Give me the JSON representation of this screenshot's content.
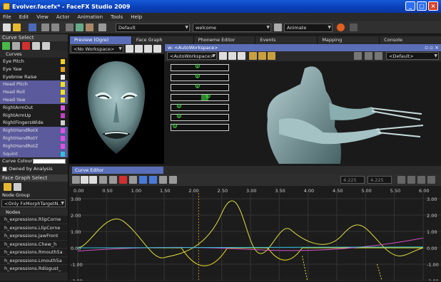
{
  "window": {
    "title": "Evolver.facefx* - FaceFX Studio 2009"
  },
  "menu": [
    "File",
    "Edit",
    "View",
    "Actor",
    "Animation",
    "Tools",
    "Help"
  ],
  "toolbar": {
    "group_combo": "Default",
    "animation_combo": "welcome",
    "mode_combo": "Animate"
  },
  "curve_select": {
    "title": "Curve Select",
    "list_header": "Curves",
    "items": [
      {
        "label": "Eye Pitch",
        "selected": false,
        "color": "#f0d020"
      },
      {
        "label": "Eye Yaw",
        "selected": false,
        "color": "#e0a020"
      },
      {
        "label": "Eyebrow Raise",
        "selected": false,
        "color": "#e8e8e8"
      },
      {
        "label": "Head Pitch",
        "selected": true,
        "color": "#f0e020"
      },
      {
        "label": "Head Roll",
        "selected": true,
        "color": "#f0e020"
      },
      {
        "label": "Head Yaw",
        "selected": true,
        "color": "#f0e020"
      },
      {
        "label": "RightArmOut",
        "selected": false,
        "color": "#e050e0"
      },
      {
        "label": "RightArmUp",
        "selected": false,
        "color": "#c040c0"
      },
      {
        "label": "RightFingersWide",
        "selected": false,
        "color": "#d0d0d0"
      },
      {
        "label": "RightHandRotX",
        "selected": true,
        "color": "#e050e0"
      },
      {
        "label": "RightHandRotY",
        "selected": true,
        "color": "#e050e0"
      },
      {
        "label": "RightHandRotZ",
        "selected": true,
        "color": "#e050e0"
      },
      {
        "label": "Squint",
        "selected": true,
        "color": "#30c0e0"
      }
    ],
    "colour_label": "Curve Colour:",
    "owned_by_analysis": "Owned by Analysis"
  },
  "face_graph_select": {
    "title": "Face Graph Select",
    "node_group_label": "Node Group",
    "node_group_value": "<Only FxMorphTargetN...",
    "nodes_header": "Nodes",
    "nodes": [
      "h_expressions.RlipCorne",
      "h_expressions.LlipCorne",
      "h_expressions.JawFront",
      "h_expressions.Chew_h",
      "h_expressions.Rmouth5a",
      "h_expressions.Lmouth5a",
      "h_expressions.Rdisgust_"
    ]
  },
  "tabs": [
    {
      "label": "Preview (Ogre)",
      "active": true
    },
    {
      "label": "Face Graph",
      "active": false
    },
    {
      "label": "Phoneme Editor",
      "active": false
    },
    {
      "label": "Events",
      "active": false
    },
    {
      "label": "Mapping",
      "active": false
    },
    {
      "label": "Console",
      "active": false
    }
  ],
  "preview": {
    "workspace_combo": "<No Workspace>"
  },
  "workspace": {
    "title": "w: <AutoWorkspace>",
    "combo": "<AutoWorkspace>",
    "right_combo": "<Default>",
    "slider_glyph": "Φ"
  },
  "curve_editor": {
    "tab_label": "Curve Editor",
    "time_field_1": "4.225",
    "time_field_2": "4.225",
    "x_ticks": [
      "0.00",
      "0.50",
      "1.00",
      "1.50",
      "2.00",
      "2.50",
      "3.00",
      "3.50",
      "4.00",
      "4.50",
      "5.00",
      "5.50",
      "6.00"
    ],
    "y_ticks": [
      "3.00",
      "2.00",
      "1.00",
      "0.00",
      "-1.00",
      "-2.00"
    ]
  }
}
